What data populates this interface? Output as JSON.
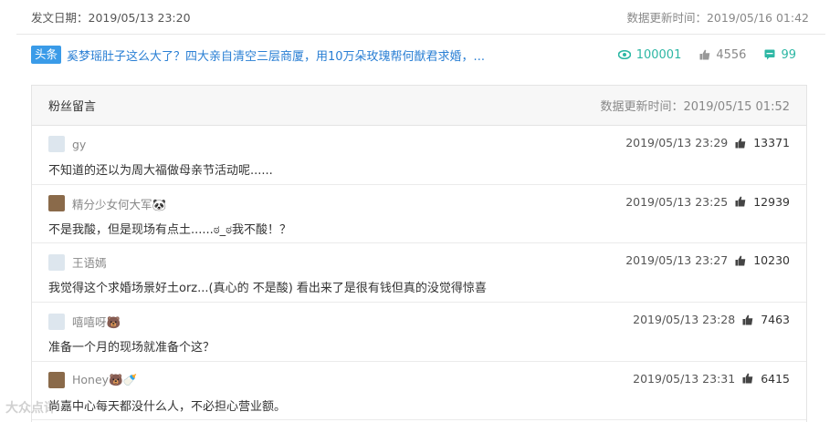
{
  "header": {
    "publish_label": "发文日期：2019/05/13 23:20",
    "update_label": "数据更新时间：2019/05/16 01:42"
  },
  "article": {
    "badge": "头条",
    "headline": "奚梦瑶肚子这么大了？四大亲自清空三层商厦，用10万朵玫瑰帮何猷君求婚，...",
    "views": "100001",
    "likes": "4556",
    "comments": "99"
  },
  "panel": {
    "title": "粉丝留言",
    "update_label": "数据更新时间：2019/05/15 01:52"
  },
  "comments": [
    {
      "user": "gy",
      "time": "2019/05/13 23:29",
      "likes": "13371",
      "text": "不知道的还以为周大福做母亲节活动呢......"
    },
    {
      "user": "精分少女何大军🐼",
      "time": "2019/05/13 23:25",
      "likes": "12939",
      "text": "不是我酸，但是现场有点土......ಠ_ಠ我不酸！？"
    },
    {
      "user": "王语嫣",
      "time": "2019/05/13 23:27",
      "likes": "10230",
      "text": "我觉得这个求婚场景好土orz...(真心的 不是酸) 看出来了是很有钱但真的没觉得惊喜"
    },
    {
      "user": "嘻嘻呀🐻",
      "time": "2019/05/13 23:28",
      "likes": "7463",
      "text": "准备一个月的现场就准备个这？"
    },
    {
      "user": "Honey🐻🍼",
      "time": "2019/05/13 23:31",
      "likes": "6415",
      "text": "尚嘉中心每天都没什么人，不必担心营业额。"
    }
  ],
  "watermark": "大众点评",
  "colors": {
    "accent": "#3a9be8",
    "link": "#2a7fd4",
    "teal": "#2db7a4"
  }
}
